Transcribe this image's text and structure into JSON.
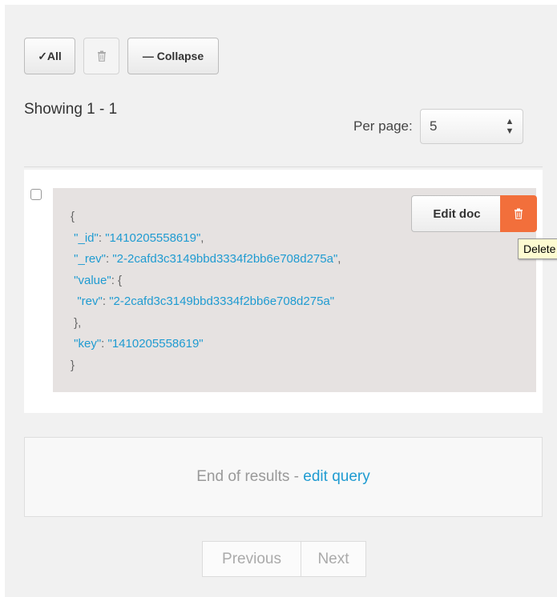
{
  "toolbar": {
    "select_all_label": "✓All",
    "collapse_label": "— Collapse"
  },
  "status": {
    "showing": "Showing 1 - 1",
    "per_page_label": "Per page:",
    "per_page_value": "5"
  },
  "document": {
    "lines": [
      [
        {
          "t": "{",
          "c": "p"
        }
      ],
      [
        {
          "t": " ",
          "c": "p"
        },
        {
          "t": "\"_id\"",
          "c": "k"
        },
        {
          "t": ": ",
          "c": "p"
        },
        {
          "t": "\"1410205558619\"",
          "c": "v"
        },
        {
          "t": ",",
          "c": "p"
        }
      ],
      [
        {
          "t": " ",
          "c": "p"
        },
        {
          "t": "\"_rev\"",
          "c": "k"
        },
        {
          "t": ": ",
          "c": "p"
        },
        {
          "t": "\"2-2cafd3c3149bbd3334f2bb6e708d275a\"",
          "c": "v"
        },
        {
          "t": ",",
          "c": "p"
        }
      ],
      [
        {
          "t": " ",
          "c": "p"
        },
        {
          "t": "\"value\"",
          "c": "k"
        },
        {
          "t": ": {",
          "c": "p"
        }
      ],
      [
        {
          "t": "  ",
          "c": "p"
        },
        {
          "t": "\"rev\"",
          "c": "k"
        },
        {
          "t": ": ",
          "c": "p"
        },
        {
          "t": "\"2-2cafd3c3149bbd3334f2bb6e708d275a\"",
          "c": "v"
        }
      ],
      [
        {
          "t": " },",
          "c": "p"
        }
      ],
      [
        {
          "t": " ",
          "c": "p"
        },
        {
          "t": "\"key\"",
          "c": "k"
        },
        {
          "t": ": ",
          "c": "p"
        },
        {
          "t": "\"1410205558619\"",
          "c": "v"
        }
      ],
      [
        {
          "t": "}",
          "c": "p"
        }
      ]
    ],
    "edit_label": "Edit doc",
    "delete_tooltip": "Delete"
  },
  "results_footer": {
    "end_text": "End of results - ",
    "edit_query_link": "edit query"
  },
  "pagination": {
    "previous_label": "Previous",
    "next_label": "Next"
  },
  "colors": {
    "link": "#1f9bd1",
    "delete_button": "#f26f3b",
    "doc_background": "#e6e2e1"
  }
}
